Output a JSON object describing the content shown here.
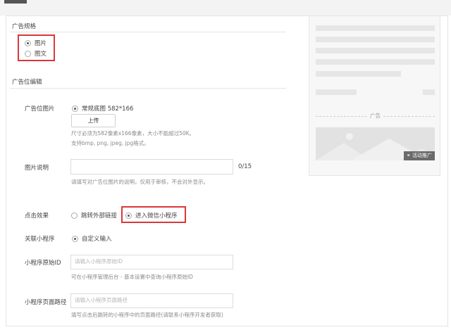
{
  "spec": {
    "title": "广告规格",
    "options": [
      {
        "label": "图片",
        "selected": true
      },
      {
        "label": "图文",
        "selected": false
      }
    ]
  },
  "edit": {
    "title": "广告位编辑",
    "image": {
      "label": "广告位图片",
      "option": "常规底图 582*166",
      "upload_label": "上传",
      "hint1": "尺寸必须为582像素x166像素，大小不能超过50K。",
      "hint2": "支持bmp, png, jpeg, jpg格式。"
    },
    "desc": {
      "label": "图片说明",
      "value": "",
      "counter": "0/15",
      "hint": "请填写对广告位图片的说明，仅用于审核，不会对外显示。"
    },
    "click": {
      "label": "点击效果",
      "options": [
        {
          "label": "跳转外部链接",
          "selected": false
        },
        {
          "label": "进入微信小程序",
          "selected": true
        }
      ]
    },
    "miniapp": {
      "label": "关联小程序",
      "option": "自定义输入"
    },
    "origin_id": {
      "label": "小程序原始ID",
      "placeholder": "请输入小程序原始ID",
      "hint": "可在小程序管理后台 - 基本设置中查询小程序原始ID"
    },
    "page_path": {
      "label": "小程序页面路径",
      "placeholder": "请输入小程序页面路径",
      "hint": "填写点击后跳转的小程序中的页面路径(请联系小程序开发者获取)"
    }
  },
  "preview": {
    "ad_label": "广告",
    "promo_tag": "活动推广"
  },
  "colors": {
    "highlight": "#d9383a",
    "preview_bg": "#f7f7f7"
  }
}
